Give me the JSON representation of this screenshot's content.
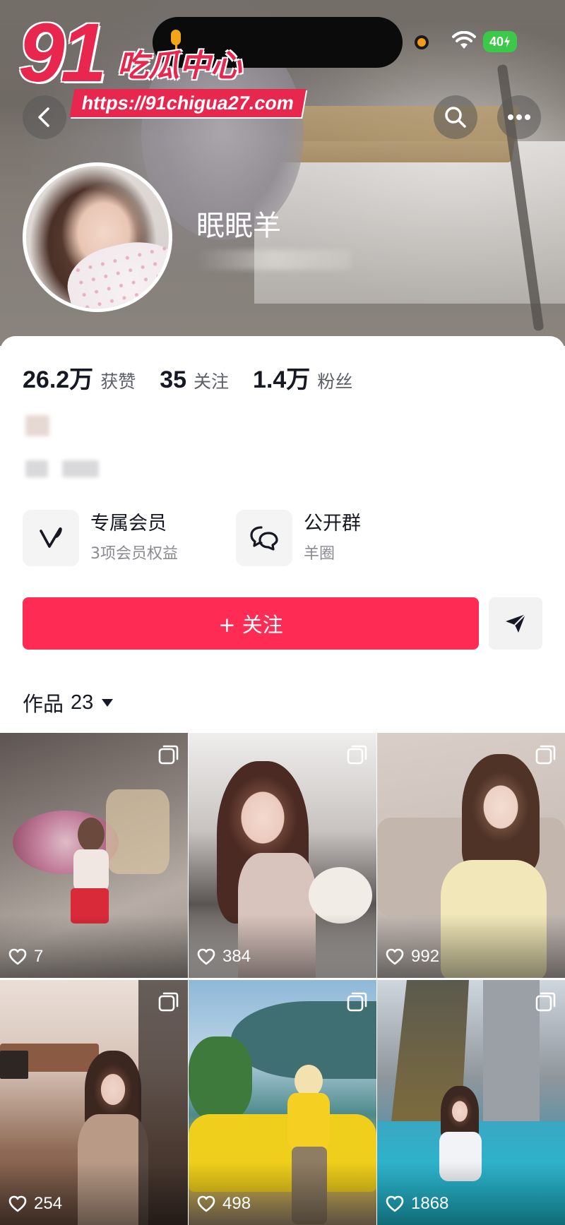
{
  "status_bar": {
    "battery": "40"
  },
  "watermark": {
    "number": "91",
    "brand": "吃瓜中心",
    "url": "https://91chigua27.com"
  },
  "profile": {
    "nickname": "眠眠羊"
  },
  "stats": [
    {
      "value": "26.2万",
      "label": "获赞"
    },
    {
      "value": "35",
      "label": "关注"
    },
    {
      "value": "1.4万",
      "label": "粉丝"
    }
  ],
  "features": [
    {
      "title": "专属会员",
      "subtitle": "3项会员权益",
      "icon": "v-member-icon"
    },
    {
      "title": "公开群",
      "subtitle": "羊圈",
      "icon": "group-chat-icon"
    }
  ],
  "actions": {
    "follow_label": "+ 关注"
  },
  "works_tab": {
    "label": "作品",
    "count": "23"
  },
  "posts": [
    {
      "likes": "7"
    },
    {
      "likes": "384"
    },
    {
      "likes": "992"
    },
    {
      "likes": "254"
    },
    {
      "likes": "498"
    },
    {
      "likes": "1868"
    }
  ],
  "colors": {
    "accent": "#fe2c55",
    "watermark": "#e8274f",
    "battery": "#3cc94a"
  }
}
